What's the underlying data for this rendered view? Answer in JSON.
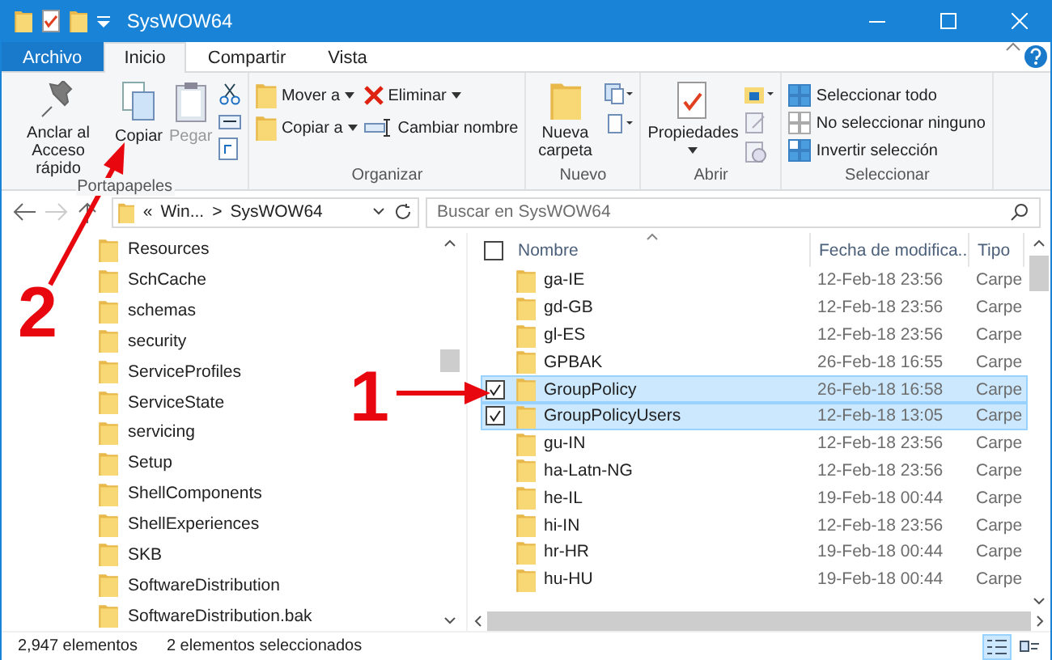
{
  "window": {
    "title": "SysWOW64"
  },
  "ribbon_tabs": [
    {
      "label": "Archivo",
      "kind": "file",
      "selected": false
    },
    {
      "label": "Inicio",
      "kind": "tab",
      "selected": true
    },
    {
      "label": "Compartir",
      "kind": "tab",
      "selected": false
    },
    {
      "label": "Vista",
      "kind": "tab",
      "selected": false
    }
  ],
  "ribbon": {
    "clipboard": {
      "label": "Portapapeles",
      "pin": "Anclar al Acceso rápido",
      "copy": "Copiar",
      "paste": {
        "label": "Pegar",
        "disabled": true
      }
    },
    "organize": {
      "label": "Organizar",
      "move_to": "Mover a",
      "copy_to": "Copiar a",
      "delete": "Eliminar",
      "rename": "Cambiar nombre"
    },
    "new": {
      "label": "Nuevo",
      "new_folder": "Nueva carpeta"
    },
    "open": {
      "label": "Abrir",
      "properties": "Propiedades"
    },
    "select": {
      "label": "Seleccionar",
      "items": [
        "Seleccionar todo",
        "No seleccionar ninguno",
        "Invertir selección"
      ]
    }
  },
  "address": {
    "overflow": "«",
    "parent": "Win...",
    "separator": ">",
    "current": "SysWOW64"
  },
  "search": {
    "placeholder": "Buscar en SysWOW64"
  },
  "tree": [
    "Resources",
    "SchCache",
    "schemas",
    "security",
    "ServiceProfiles",
    "ServiceState",
    "servicing",
    "Setup",
    "ShellComponents",
    "ShellExperiences",
    "SKB",
    "SoftwareDistribution",
    "SoftwareDistribution.bak"
  ],
  "columns": [
    "Nombre",
    "Fecha de modifica...",
    "Tipo"
  ],
  "header_checked": false,
  "files": [
    {
      "name": "ga-IE",
      "modified": "12-Feb-18 23:56",
      "type": "Carpe",
      "selected": false
    },
    {
      "name": "gd-GB",
      "modified": "12-Feb-18 23:56",
      "type": "Carpe",
      "selected": false
    },
    {
      "name": "gl-ES",
      "modified": "12-Feb-18 23:56",
      "type": "Carpe",
      "selected": false
    },
    {
      "name": "GPBAK",
      "modified": "26-Feb-18 16:55",
      "type": "Carpe",
      "selected": false
    },
    {
      "name": "GroupPolicy",
      "modified": "26-Feb-18 16:58",
      "type": "Carpe",
      "selected": true
    },
    {
      "name": "GroupPolicyUsers",
      "modified": "12-Feb-18 13:05",
      "type": "Carpe",
      "selected": true
    },
    {
      "name": "gu-IN",
      "modified": "12-Feb-18 23:56",
      "type": "Carpe",
      "selected": false
    },
    {
      "name": "ha-Latn-NG",
      "modified": "12-Feb-18 23:56",
      "type": "Carpe",
      "selected": false
    },
    {
      "name": "he-IL",
      "modified": "19-Feb-18 00:44",
      "type": "Carpe",
      "selected": false
    },
    {
      "name": "hi-IN",
      "modified": "12-Feb-18 23:56",
      "type": "Carpe",
      "selected": false
    },
    {
      "name": "hr-HR",
      "modified": "19-Feb-18 00:44",
      "type": "Carpe",
      "selected": false
    },
    {
      "name": "hu-HU",
      "modified": "19-Feb-18 00:44",
      "type": "Carpe",
      "selected": false
    }
  ],
  "status": {
    "count": "2,947 elementos",
    "selection": "2 elementos seleccionados"
  },
  "views": [
    {
      "kind": "details",
      "selected": true
    },
    {
      "kind": "tiles",
      "selected": false
    }
  ],
  "annotations": [
    {
      "label": "1"
    },
    {
      "label": "2"
    }
  ]
}
